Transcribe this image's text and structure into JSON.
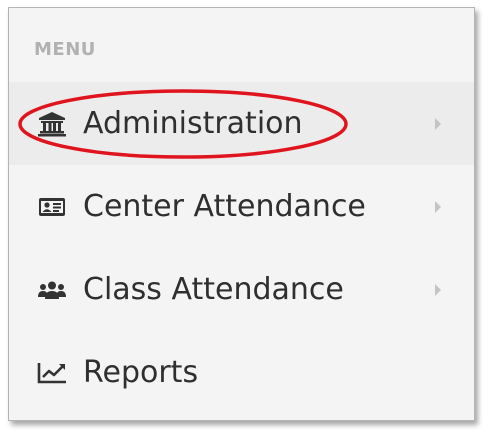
{
  "menu": {
    "header": "MENU",
    "items": [
      {
        "label": "Administration",
        "icon": "bank-icon",
        "has_submenu": true,
        "active": true
      },
      {
        "label": "Center Attendance",
        "icon": "id-card-icon",
        "has_submenu": true,
        "active": false
      },
      {
        "label": "Class Attendance",
        "icon": "users-icon",
        "has_submenu": true,
        "active": false
      },
      {
        "label": "Reports",
        "icon": "line-chart-icon",
        "has_submenu": false,
        "active": false
      }
    ]
  },
  "colors": {
    "panel_background": "#f4f4f4",
    "active_row_background": "#ececec",
    "label_text": "#2f2f2f",
    "header_text": "#b1b1b1",
    "icon": "#333333",
    "chevron": "#c4c4c4",
    "highlight_ellipse": "#e0141e"
  }
}
